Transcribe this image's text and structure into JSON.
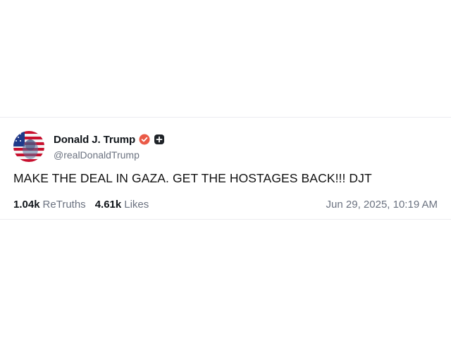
{
  "post": {
    "display_name": "Donald J. Trump",
    "handle": "@realDonaldTrump",
    "text": "MAKE THE DEAL IN GAZA. GET THE HOSTAGES BACK!!! DJT",
    "retruths_count": "1.04k",
    "retruths_label": "ReTruths",
    "likes_count": "4.61k",
    "likes_label": "Likes",
    "timestamp": "Jun 29, 2025, 10:19 AM"
  },
  "icons": {
    "avatar": "flag-portrait-avatar",
    "verified": "verified-badge-icon",
    "follow": "plus-badge-icon"
  },
  "colors": {
    "verified_badge": "#ea5a47",
    "follow_badge": "#1f2328",
    "text_primary": "#0f1419",
    "text_secondary": "#6b7280"
  }
}
